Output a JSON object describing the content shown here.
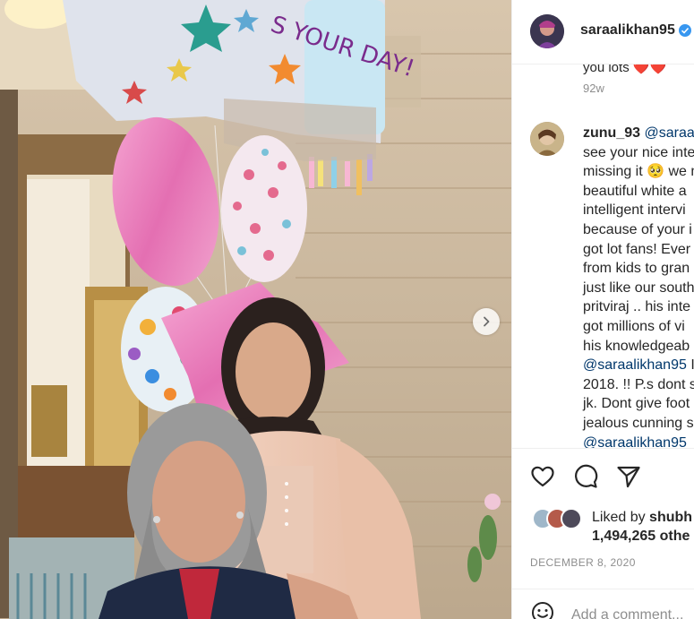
{
  "header": {
    "username": "saraalikhan95",
    "verified_icon": "verified-badge-icon"
  },
  "photo": {
    "next_icon": "chevron-right-icon",
    "balloon_text": "S YOUR DAY!"
  },
  "comments": {
    "previous": {
      "text": "you lots ❤️❤️",
      "time": "92w"
    },
    "comment": {
      "username": "zunu_93",
      "mention": "@saraal",
      "lines": [
        "see your nice inte",
        "missing it 🥺 we m",
        "beautiful white a",
        "intelligent intervi",
        "because of your i",
        "got lot fans! Ever",
        "from kids to gran",
        "just like our south",
        "pritviraj .. his inte",
        "got millions of vi",
        "his knowledgeab"
      ],
      "mention_line": "@saraalikhan95",
      "after_mention": " I",
      "lines_after": [
        "2018. !! P.s dont s",
        "jk. Dont give foot",
        "jealous cunning s"
      ],
      "last_mention": "@saraalikhan95"
    }
  },
  "actions": {
    "like_icon": "heart-icon",
    "comment_icon": "comment-icon",
    "share_icon": "share-icon",
    "liked_by_prefix": "Liked by ",
    "liked_by_user": "shubh",
    "likes_count": "1,494,265 othe",
    "date": "DECEMBER 8, 2020"
  },
  "add_comment": {
    "emoji_icon": "emoji-icon",
    "placeholder": "Add a comment..."
  },
  "colors": {
    "link": "#00376b",
    "muted": "#8e8e8e",
    "verified": "#3897f0",
    "border": "#efefef"
  }
}
